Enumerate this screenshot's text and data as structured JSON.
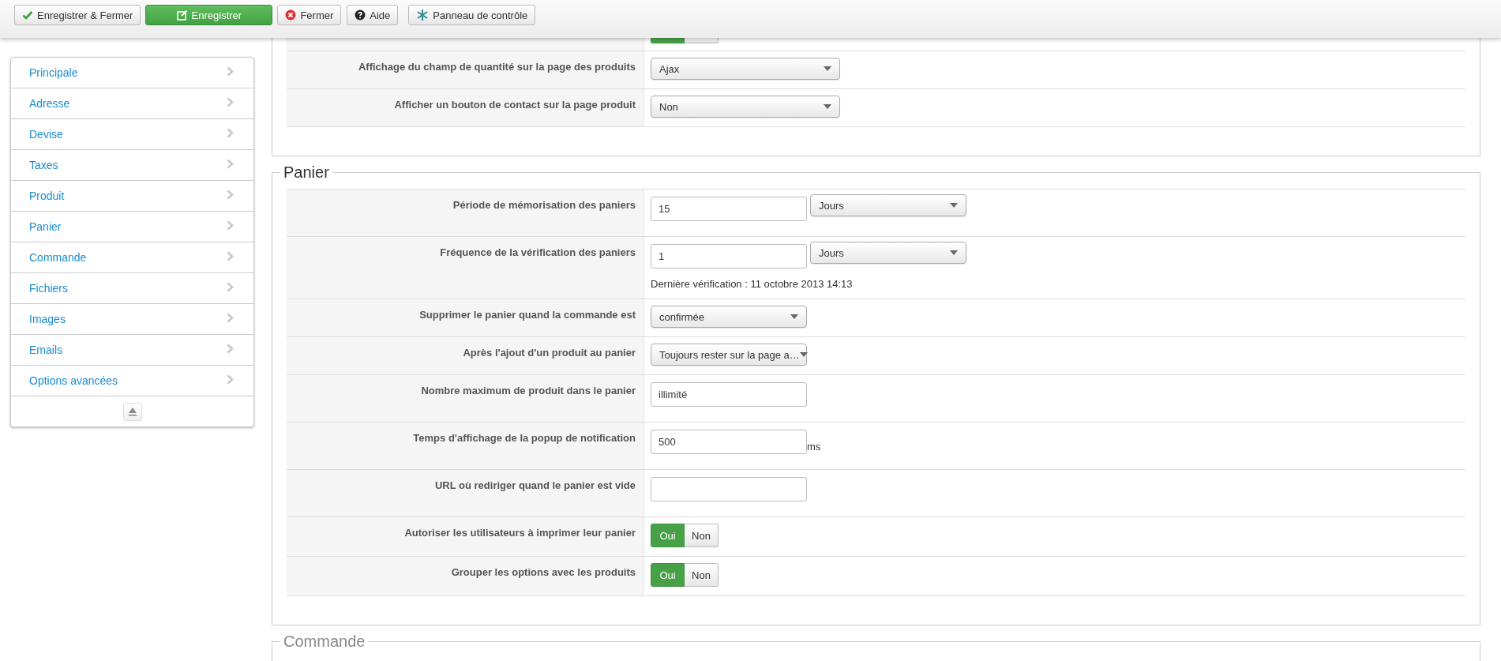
{
  "toolbar": {
    "buttons": [
      {
        "label": "Enregistrer & Fermer",
        "kind": "default"
      },
      {
        "label": "Enregistrer",
        "kind": "primary"
      },
      {
        "label": "Fermer",
        "kind": "default"
      },
      {
        "label": "Aide",
        "kind": "default"
      },
      {
        "label": "Panneau de contrôle",
        "kind": "default"
      }
    ]
  },
  "sidebar": {
    "items": [
      {
        "label": "Principale"
      },
      {
        "label": "Adresse"
      },
      {
        "label": "Devise"
      },
      {
        "label": "Taxes"
      },
      {
        "label": "Produit"
      },
      {
        "label": "Panier"
      },
      {
        "label": "Commande"
      },
      {
        "label": "Fichiers"
      },
      {
        "label": "Images"
      },
      {
        "label": "Emails"
      },
      {
        "label": "Options avancées"
      }
    ]
  },
  "sections": [
    {
      "rows": [
        {
          "kind": "toggle",
          "options": [
            {
              "selected": true
            },
            {
              "selected": false
            }
          ]
        },
        {
          "kind": "select",
          "label": "Affichage du champ de quantité sur la page des produits",
          "value": "Ajax"
        },
        {
          "kind": "select",
          "label": "Afficher un bouton de contact sur la page produit",
          "value": "Non"
        }
      ]
    },
    {
      "legend": "Panier",
      "rows": [
        {
          "kind": "input_select",
          "label": "Période de mémorisation des paniers",
          "value": "15",
          "unit": "Jours"
        },
        {
          "kind": "input_select",
          "label": "Fréquence de la vérification des paniers",
          "value": "1",
          "unit": "Jours",
          "note": "Dernière vérification : 11 octobre 2013 14:13"
        },
        {
          "kind": "select_small",
          "label": "Supprimer le panier quand la commande est",
          "value": "confirmée"
        },
        {
          "kind": "select_small",
          "label": "Après l'ajout d'un produit au panier",
          "value": "Toujours rester sur la page a…"
        },
        {
          "kind": "input",
          "label": "Nombre maximum de produit dans le panier",
          "value": "illimité"
        },
        {
          "kind": "input",
          "label": "Temps d'affichage de la popup de notification",
          "value": "500",
          "suffix": "ms"
        },
        {
          "kind": "input",
          "label": "URL où rediriger quand le panier est vide"
        },
        {
          "kind": "toggle",
          "label": "Autoriser les utilisateurs à imprimer leur panier",
          "options": [
            {
              "label": "Oui",
              "selected": true
            },
            {
              "label": "Non",
              "selected": false
            }
          ]
        },
        {
          "kind": "toggle",
          "label": "Grouper les options avec les produits",
          "options": [
            {
              "label": "Oui",
              "selected": true
            },
            {
              "label": "Non",
              "selected": false
            }
          ]
        }
      ]
    },
    {
      "legend": "Commande"
    }
  ]
}
